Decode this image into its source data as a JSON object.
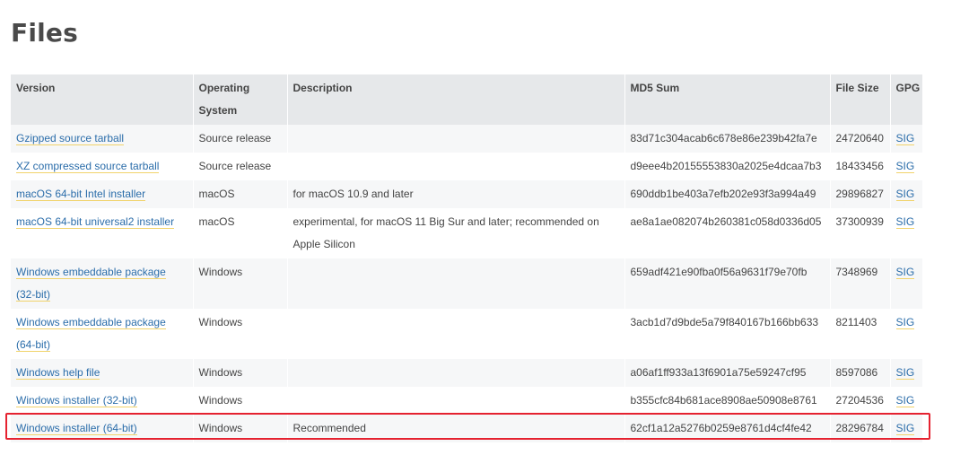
{
  "page": {
    "title": "Files"
  },
  "table": {
    "headers": {
      "version": "Version",
      "os": "Operating System",
      "description": "Description",
      "md5": "MD5 Sum",
      "size": "File Size",
      "gpg": "GPG"
    },
    "rows": [
      {
        "version": "Gzipped source tarball",
        "os": "Source release",
        "description": "",
        "md5": "83d71c304acab6c678e86e239b42fa7e",
        "size": "24720640",
        "gpg": "SIG"
      },
      {
        "version": "XZ compressed source tarball",
        "os": "Source release",
        "description": "",
        "md5": "d9eee4b20155553830a2025e4dcaa7b3",
        "size": "18433456",
        "gpg": "SIG"
      },
      {
        "version": "macOS 64-bit Intel installer",
        "os": "macOS",
        "description": "for macOS 10.9 and later",
        "md5": "690ddb1be403a7efb202e93f3a994a49",
        "size": "29896827",
        "gpg": "SIG"
      },
      {
        "version": "macOS 64-bit universal2 installer",
        "os": "macOS",
        "description": "experimental, for macOS 11 Big Sur and later; recommended on Apple Silicon",
        "md5": "ae8a1ae082074b260381c058d0336d05",
        "size": "37300939",
        "gpg": "SIG"
      },
      {
        "version": "Windows embeddable package (32-bit)",
        "os": "Windows",
        "description": "",
        "md5": "659adf421e90fba0f56a9631f79e70fb",
        "size": "7348969",
        "gpg": "SIG"
      },
      {
        "version": "Windows embeddable package (64-bit)",
        "os": "Windows",
        "description": "",
        "md5": "3acb1d7d9bde5a79f840167b166bb633",
        "size": "8211403",
        "gpg": "SIG"
      },
      {
        "version": "Windows help file",
        "os": "Windows",
        "description": "",
        "md5": "a06af1ff933a13f6901a75e59247cf95",
        "size": "8597086",
        "gpg": "SIG"
      },
      {
        "version": "Windows installer (32-bit)",
        "os": "Windows",
        "description": "",
        "md5": "b355cfc84b681ace8908ae50908e8761",
        "size": "27204536",
        "gpg": "SIG"
      },
      {
        "version": "Windows installer (64-bit)",
        "os": "Windows",
        "description": "Recommended",
        "md5": "62cf1a12a5276b0259e8761d4cf4fe42",
        "size": "28296784",
        "gpg": "SIG"
      }
    ]
  },
  "highlight": {
    "color": "#e52230"
  }
}
